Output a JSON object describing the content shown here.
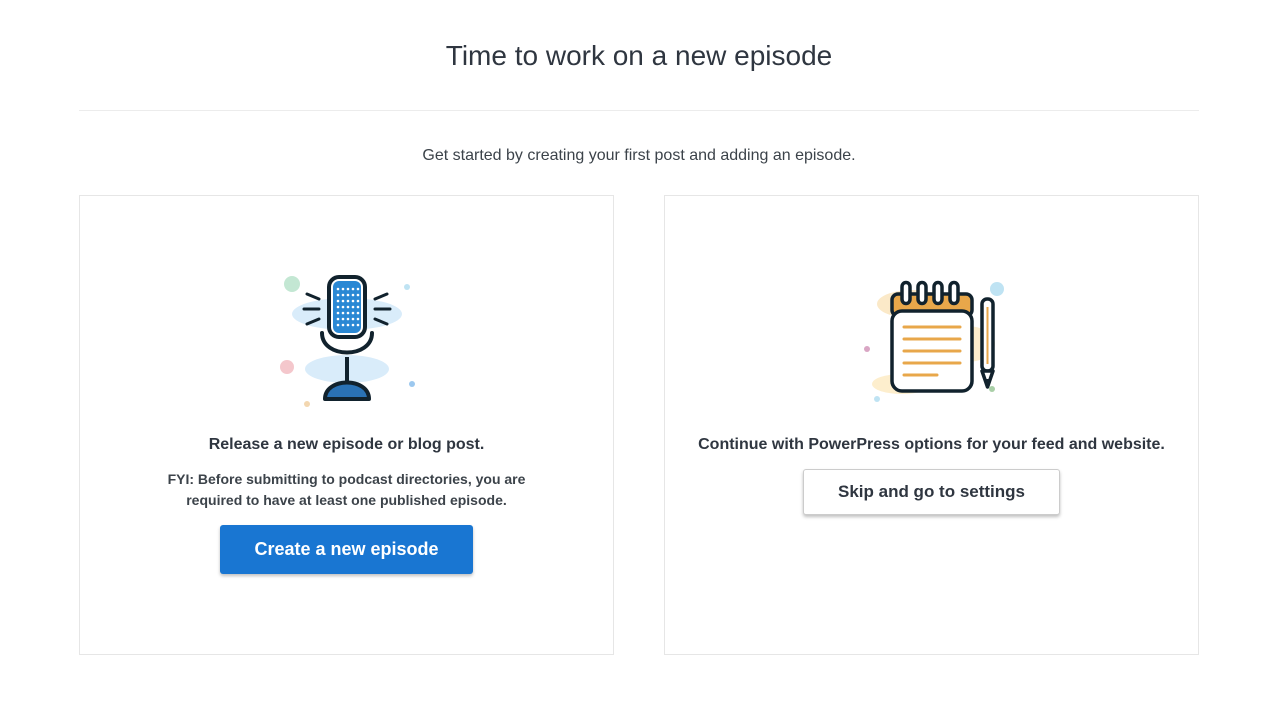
{
  "header": {
    "title": "Time to work on a new episode",
    "subtitle": "Get started by creating your first post and adding an episode."
  },
  "cards": {
    "create": {
      "heading": "Release a new episode or blog post.",
      "note": "FYI: Before submitting to podcast directories, you are required to have at least one published episode.",
      "button_label": "Create a new episode"
    },
    "settings": {
      "heading": "Continue with PowerPress options for your feed and website.",
      "button_label": "Skip and go to settings"
    }
  }
}
